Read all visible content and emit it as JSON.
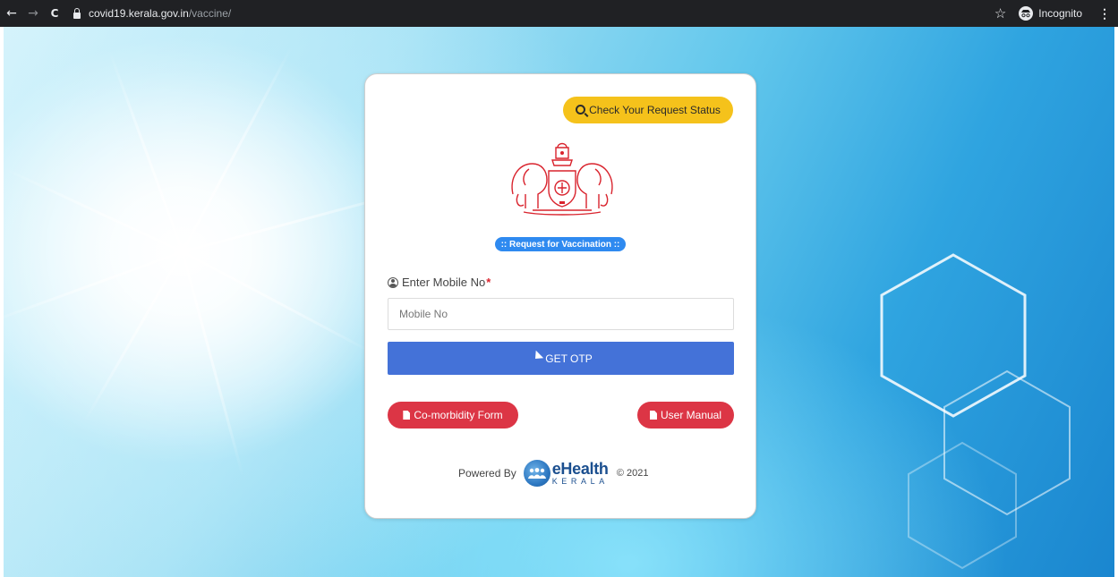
{
  "browser": {
    "back_glyph": "←",
    "forward_glyph": "→",
    "reload_glyph": "C",
    "url_host": "covid19.kerala.gov.in",
    "url_path": "/vaccine/",
    "bookmark_glyph": "☆",
    "incognito_label": "Incognito",
    "menu_glyph": "⋮"
  },
  "card": {
    "status_button": "Check Your Request Status",
    "badge": ":: Request for Vaccination ::",
    "mobile_label": "Enter Mobile No",
    "required_mark": "*",
    "mobile_placeholder": "Mobile No",
    "otp_button": "GET OTP",
    "comorbidity_button": "Co-morbidity Form",
    "manual_button": "User Manual"
  },
  "footer": {
    "powered_by": "Powered By",
    "logo_name": "eHealth",
    "logo_sub": "KERALA",
    "copyright": "© 2021"
  },
  "colors": {
    "status_yellow": "#f5c21b",
    "badge_blue": "#2f8af0",
    "otp_blue": "#4472d8",
    "pill_red": "#dc3545",
    "emblem_red": "#d9232d"
  },
  "icons": {
    "status_button": "search-icon",
    "mobile_label": "user-circle-icon",
    "otp_button": "paper-plane-icon",
    "doc_buttons": "file-icon"
  }
}
